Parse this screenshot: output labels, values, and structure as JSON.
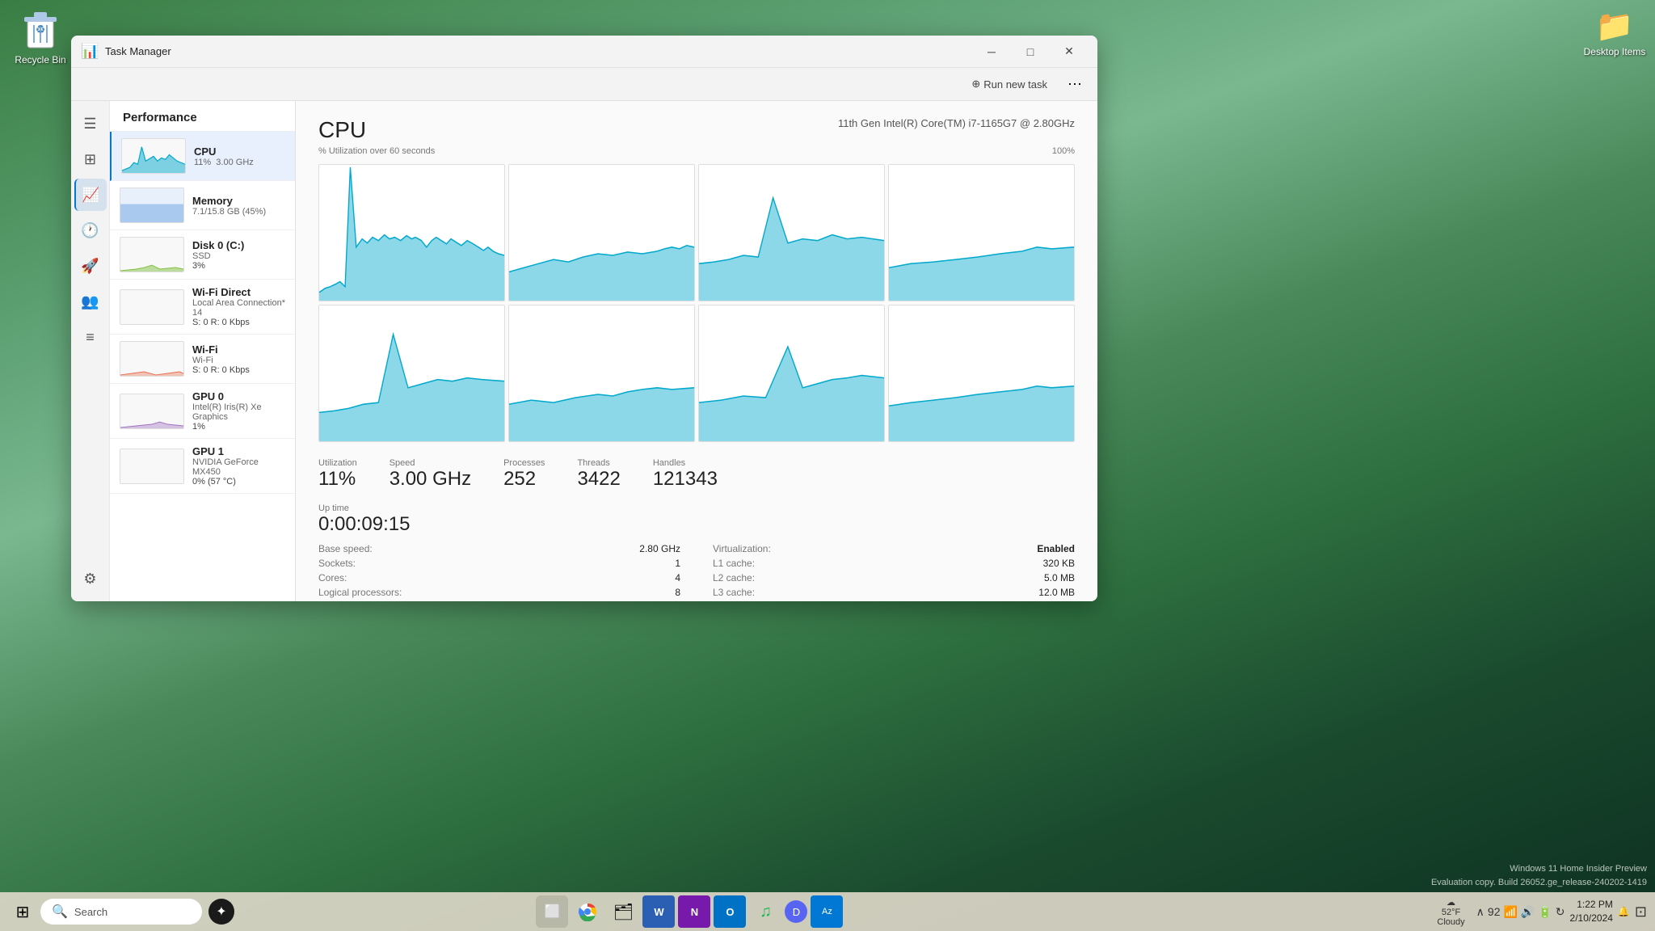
{
  "desktop": {
    "background": "landscape"
  },
  "recycle_bin": {
    "label": "Recycle Bin"
  },
  "desktop_items": {
    "label": "Desktop Items"
  },
  "taskbar": {
    "search_placeholder": "Search",
    "time": "1:22 PM",
    "date": "2/10/2024",
    "weather_temp": "52°F",
    "weather_condition": "Cloudy",
    "tray_count": "92",
    "apps": [
      {
        "name": "start-button",
        "icon": "⊞"
      },
      {
        "name": "search-app",
        "icon": "🔍"
      },
      {
        "name": "ai-copilot",
        "icon": ""
      },
      {
        "name": "task-view",
        "icon": "⬜"
      },
      {
        "name": "chrome-browser",
        "icon": ""
      },
      {
        "name": "file-explorer",
        "icon": "📁"
      },
      {
        "name": "word",
        "icon": "W"
      },
      {
        "name": "onenote",
        "icon": "N"
      },
      {
        "name": "outlook",
        "icon": "O"
      },
      {
        "name": "spotify",
        "icon": "♫"
      },
      {
        "name": "discord",
        "icon": "D"
      },
      {
        "name": "azure",
        "icon": "A"
      }
    ]
  },
  "task_manager": {
    "title": "Task Manager",
    "toolbar": {
      "run_new_task": "Run new task",
      "more_options": "⋯"
    },
    "sidebar": {
      "items": [
        {
          "name": "hamburger-menu",
          "icon": "☰"
        },
        {
          "name": "performance-tab",
          "icon": "⊞"
        },
        {
          "name": "processes-tab",
          "icon": "📊"
        },
        {
          "name": "app-history-tab",
          "icon": "🕐"
        },
        {
          "name": "startup-tab",
          "icon": "🚀"
        },
        {
          "name": "users-tab",
          "icon": "👥"
        },
        {
          "name": "details-tab",
          "icon": "☰"
        },
        {
          "name": "services-tab",
          "icon": "⚙"
        }
      ]
    },
    "performance": {
      "header": "Performance",
      "devices": [
        {
          "name": "CPU",
          "sub": "11%  3.00 GHz",
          "selected": true,
          "chart_color": "#00a8cc"
        },
        {
          "name": "Memory",
          "sub": "7.1/15.8 GB (45%)",
          "selected": false,
          "chart_color": "#4a90d9"
        },
        {
          "name": "Disk 0 (C:)",
          "sub": "SSD",
          "sub2": "3%",
          "selected": false,
          "chart_color": "#80c040"
        },
        {
          "name": "Wi-Fi Direct",
          "sub": "Local Area Connection* 14",
          "sub2": "S: 0 R: 0 Kbps",
          "selected": false,
          "chart_color": "#aaa"
        },
        {
          "name": "Wi-Fi",
          "sub": "Wi-Fi",
          "sub2": "S: 0 R: 0 Kbps",
          "selected": false,
          "chart_color": "#e87050"
        },
        {
          "name": "GPU 0",
          "sub": "Intel(R) Iris(R) Xe Graphics",
          "sub2": "1%",
          "selected": false,
          "chart_color": "#a070c0"
        },
        {
          "name": "GPU 1",
          "sub": "NVIDIA GeForce MX450",
          "sub2": "0% (57 °C)",
          "selected": false,
          "chart_color": "#aaa"
        }
      ],
      "cpu": {
        "title": "CPU",
        "model": "11th Gen Intel(R) Core(TM) i7-1165G7 @ 2.80GHz",
        "utilization_label": "% Utilization over 60 seconds",
        "percent_label": "100%",
        "utilization_pct": "11%",
        "speed": "3.00 GHz",
        "processes": "252",
        "threads": "3422",
        "handles": "121343",
        "uptime": "0:00:09:15",
        "base_speed_label": "Base speed:",
        "base_speed_val": "2.80 GHz",
        "sockets_label": "Sockets:",
        "sockets_val": "1",
        "cores_label": "Cores:",
        "cores_val": "4",
        "logical_label": "Logical processors:",
        "logical_val": "8",
        "virt_label": "Virtualization:",
        "virt_val": "Enabled",
        "l1_label": "L1 cache:",
        "l1_val": "320 KB",
        "l2_label": "L2 cache:",
        "l2_val": "5.0 MB",
        "l3_label": "L3 cache:",
        "l3_val": "12.0 MB"
      }
    }
  },
  "watermark": {
    "line1": "Windows 11 Home Insider Preview",
    "line2": "Evaluation copy. Build 26052.ge_release-240202-1419"
  }
}
